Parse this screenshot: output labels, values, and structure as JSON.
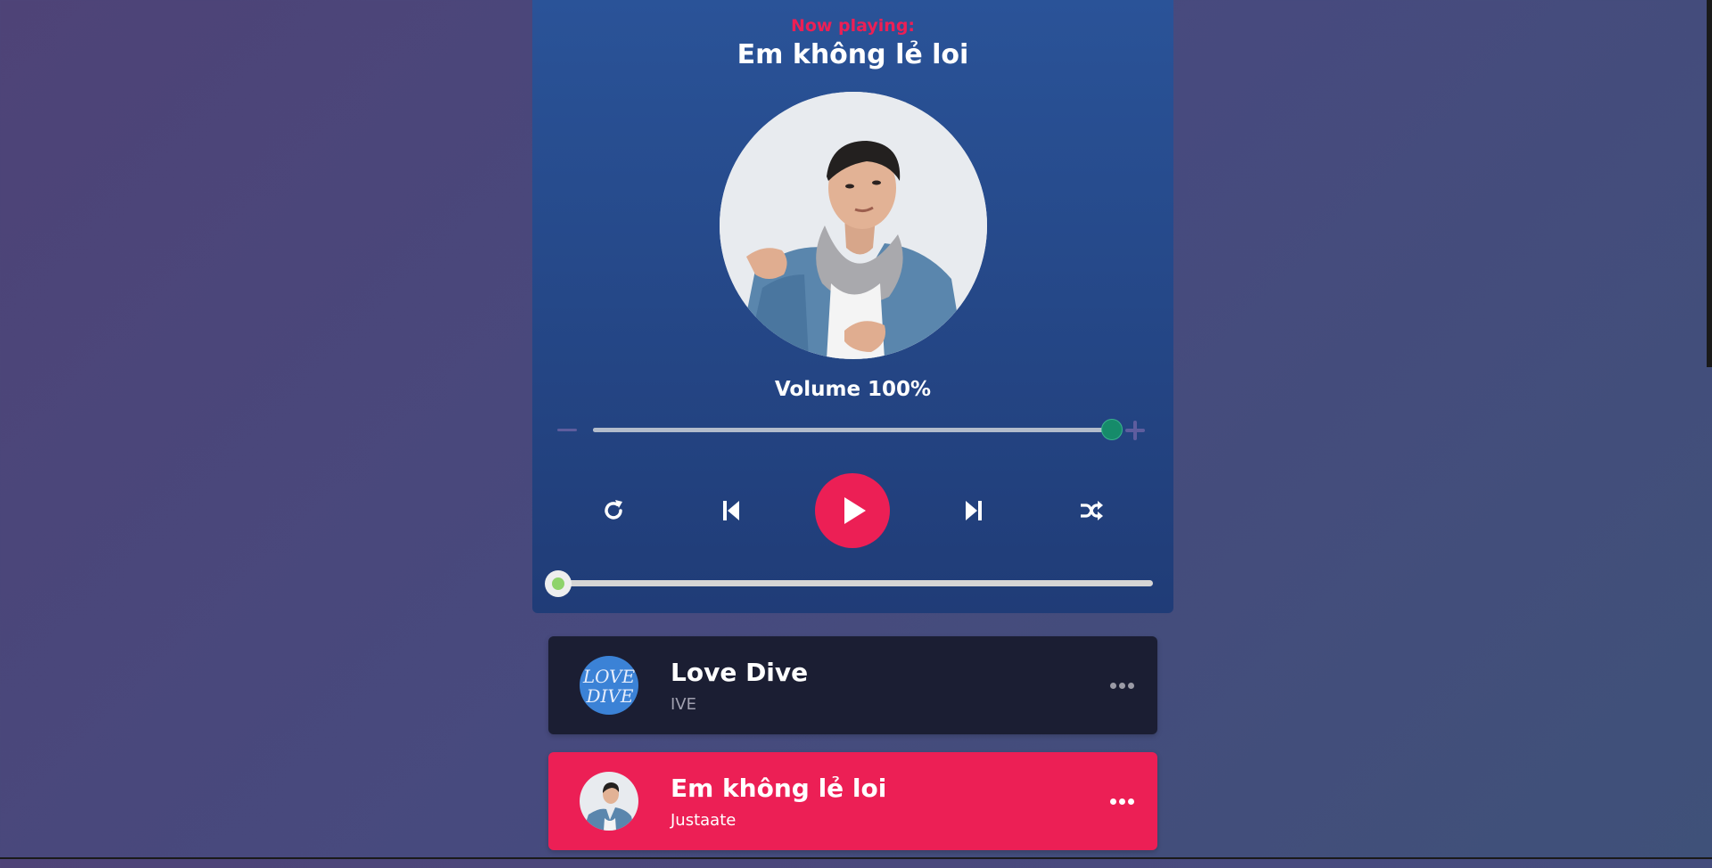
{
  "player": {
    "now_playing_label": "Now playing:",
    "current_song": "Em không lẻ loi",
    "volume_label": "Volume 100%",
    "volume_level": 1.0,
    "progress": 0.0,
    "controls": {
      "repeat": "repeat-icon",
      "prev": "skip-back-icon",
      "play": "play-icon",
      "next": "skip-forward-icon",
      "random": "shuffle-icon"
    },
    "colors": {
      "accent": "#ec1f55",
      "panel_top": "#2a5398",
      "panel_bottom": "#203c77",
      "volume_thumb": "#168b6a",
      "progress_thumb": "#8ed36a"
    }
  },
  "playlist": [
    {
      "title": "Love Dive",
      "artist": "IVE",
      "active": false,
      "thumb_text": "LOVE DIVE"
    },
    {
      "title": "Em không lẻ loi",
      "artist": "Justaate",
      "active": true
    }
  ]
}
